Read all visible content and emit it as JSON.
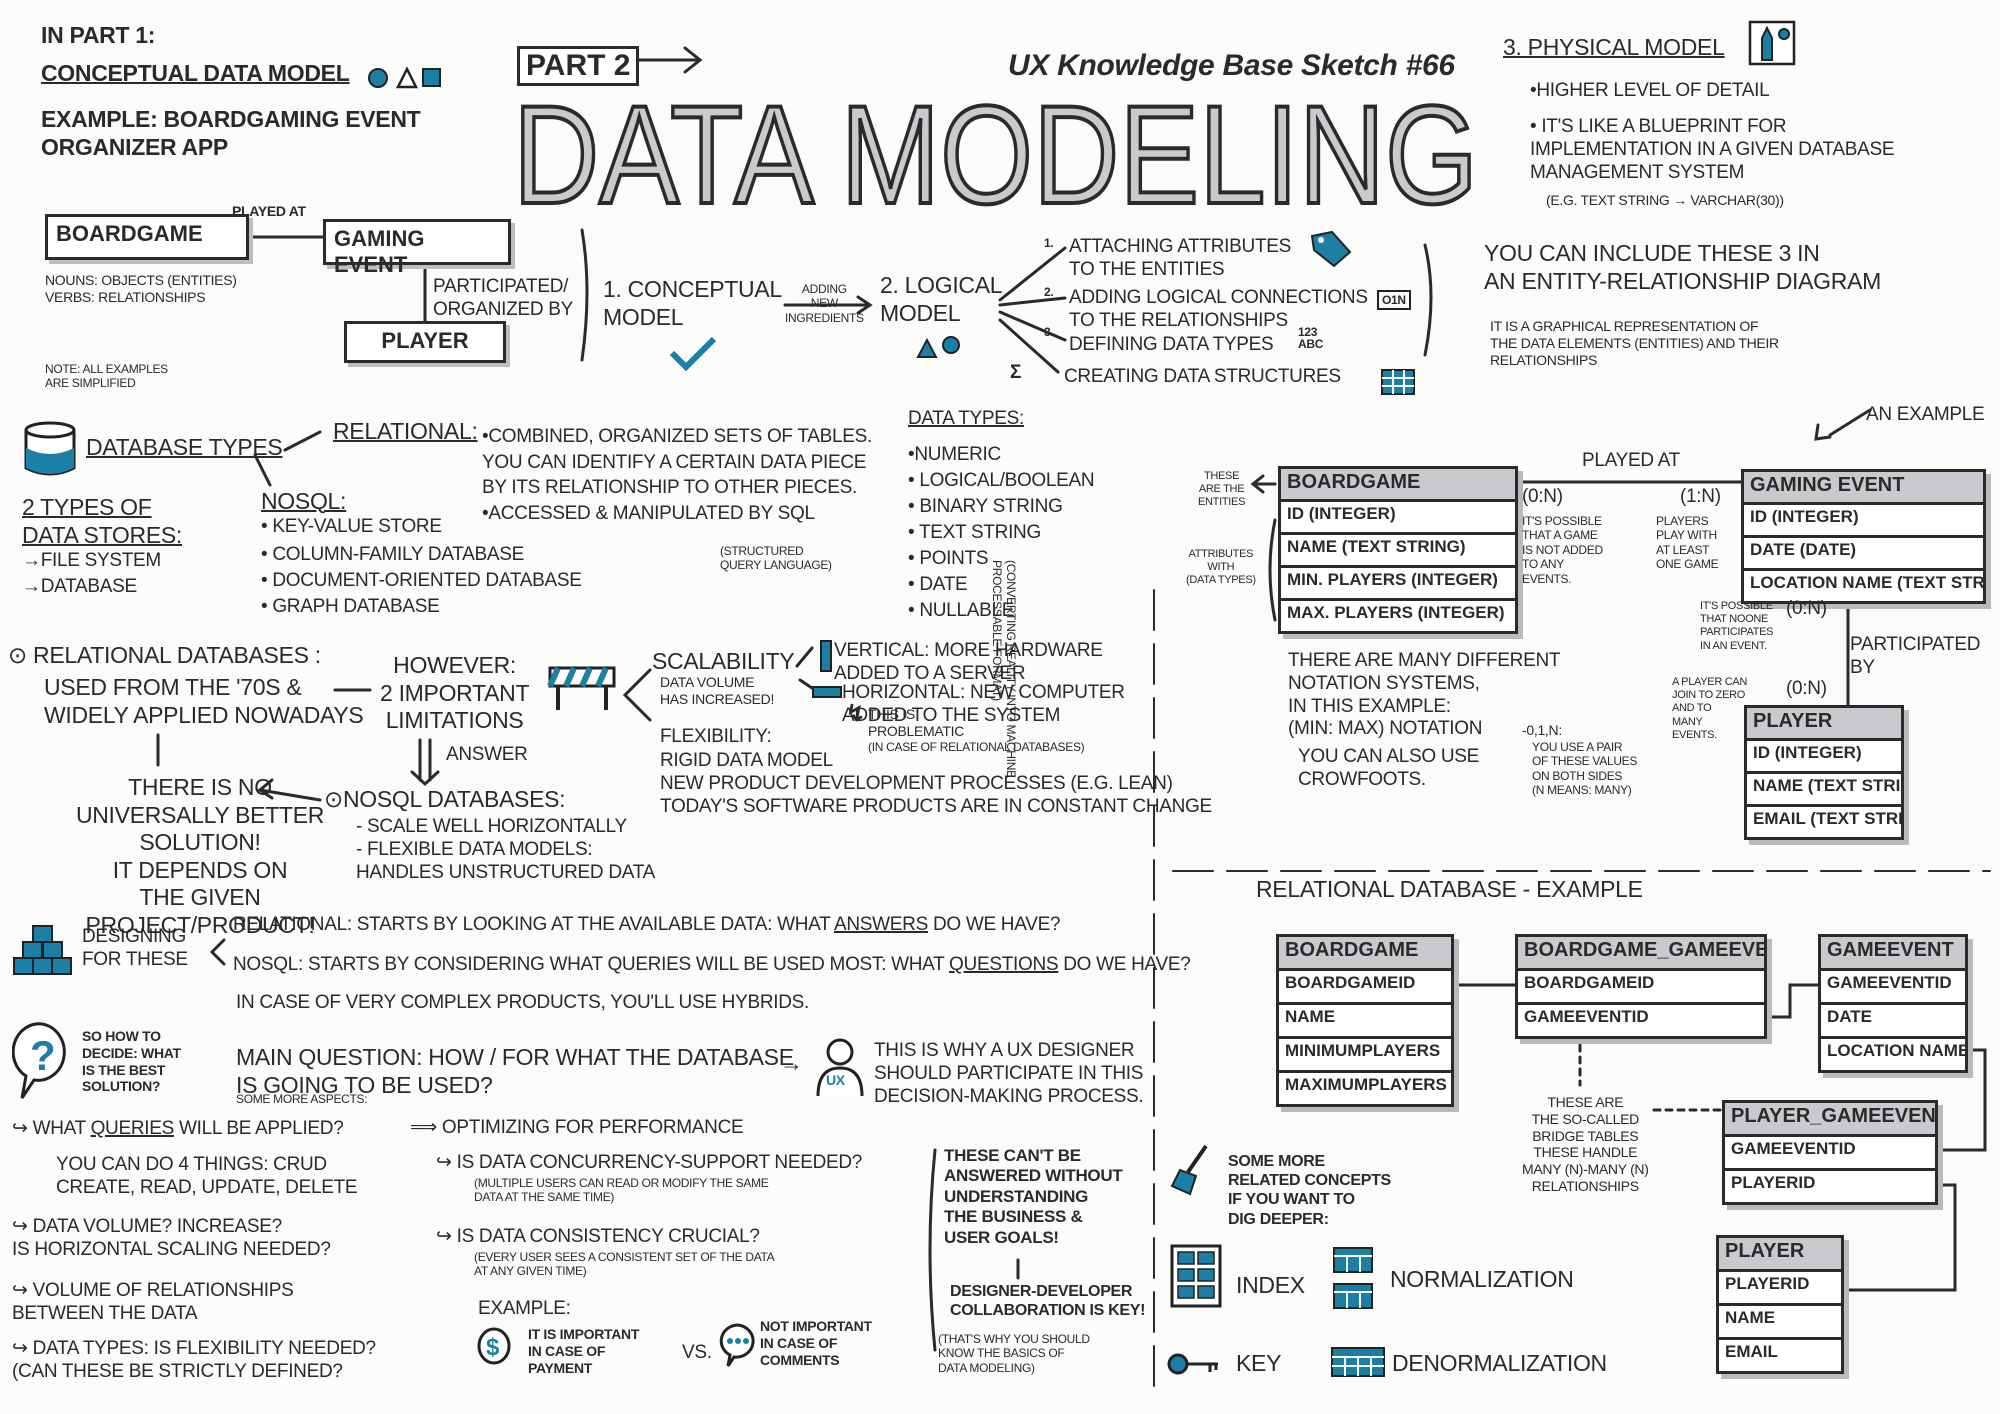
{
  "colors": {
    "accent": "#1b7fa6",
    "ink": "#2a2a2a",
    "gray_fill": "#c9cacd",
    "paper": "#fbfbfa"
  },
  "title": {
    "part": "PART 2",
    "main": "DATA MODELING",
    "series": "UX Knowledge Base Sketch #66"
  },
  "intro": {
    "part1": "IN PART 1:",
    "conceptual": "CONCEPTUAL DATA MODEL",
    "example": "EXAMPLE: BOARDGAMING EVENT\n          ORGANIZER APP"
  },
  "conceptual_example": {
    "boardgame": "BOARDGAME",
    "played_at": "PLAYED AT",
    "gaming_event": "GAMING EVENT",
    "participated": "PARTICIPATED/\nORGANIZED BY",
    "player": "PLAYER",
    "nouns": "NOUNS: OBJECTS (ENTITIES)\nVERBS: RELATIONSHIPS",
    "note": "NOTE: ALL EXAMPLES\n        ARE SIMPLIFIED"
  },
  "flow": {
    "conceptual": "1. CONCEPTUAL\n    MODEL",
    "adding": "ADDING\nNEW\nINGREDIENTS",
    "logical": "2. LOGICAL\n    MODEL",
    "steps": [
      {
        "num": "1.",
        "text": "ATTACHING ATTRIBUTES\nTO THE ENTITIES"
      },
      {
        "num": "2.",
        "text": "ADDING LOGICAL CONNECTIONS\nTO THE RELATIONSHIPS"
      },
      {
        "num": "3.",
        "text": "DEFINING DATA TYPES"
      }
    ],
    "type_badge": "123\nABC",
    "connector_badge": "O1N",
    "sigma": "Σ",
    "creating": "CREATING DATA STRUCTURES"
  },
  "physical": {
    "heading": "3. PHYSICAL MODEL",
    "bullets": [
      "•HIGHER LEVEL OF DETAIL",
      "• IT'S LIKE A BLUEPRINT FOR\n  IMPLEMENTATION IN A GIVEN DATABASE\n  MANAGEMENT SYSTEM"
    ],
    "example": "(E.G. TEXT STRING → VARCHAR(30))"
  },
  "erd_intro": {
    "text": "YOU CAN INCLUDE THESE 3 IN\nAN ENTITY-RELATIONSHIP DIAGRAM",
    "desc": "IT IS A GRAPHICAL REPRESENTATION OF\nTHE DATA ELEMENTS (ENTITIES) AND THEIR\nRELATIONSHIPS",
    "an_example": "AN EXAMPLE"
  },
  "database_types": {
    "label": "DATABASE TYPES",
    "stores": "2 TYPES OF\nDATA STORES:",
    "store_items": [
      "→FILE SYSTEM",
      "→DATABASE"
    ],
    "relational_label": "RELATIONAL:",
    "relational_text": "•COMBINED, ORGANIZED SETS OF TABLES.\n YOU CAN IDENTIFY A CERTAIN DATA PIECE\n BY ITS RELATIONSHIP TO OTHER PIECES.\n•ACCESSED & MANIPULATED BY SQL",
    "sql_note": "(STRUCTURED\nQUERY LANGUAGE)",
    "nosql_label": "NOSQL:",
    "nosql_items": [
      "• KEY-VALUE STORE",
      "• COLUMN-FAMILY DATABASE",
      "• DOCUMENT-ORIENTED DATABASE",
      "• GRAPH DATABASE"
    ]
  },
  "data_types": {
    "heading": "DATA TYPES:",
    "items": [
      "•NUMERIC",
      "• LOGICAL/BOOLEAN",
      "• BINARY STRING",
      "• TEXT STRING",
      "• POINTS",
      "• DATE",
      "• NULLABLE"
    ],
    "note": "(CONVERTING REALITY INTO MACHINE PROCESSABLE FORMAT)"
  },
  "relational_databases": {
    "heading": "⊙ RELATIONAL DATABASES :",
    "used": "USED FROM THE '70s &\nWIDELY APPLIED NOWADAYS",
    "however": "HOWEVER:\n2 IMPORTANT\nLIMITATIONS",
    "scalability": "SCALABILITY",
    "volume": "DATA VOLUME\nHAS INCREASED!",
    "vertical": "VERTICAL: MORE HARDWARE\n              ADDED TO A SERVER",
    "horizontal": "HORIZONTAL: NEW COMPUTER\n                ADDED TO THE SYSTEM",
    "problematic": "THIS IS\nPROBLEMATIC",
    "problematic_note": "(IN CASE OF RELATIONAL DATABASES)",
    "flexibility": "FLEXIBILITY:",
    "flex_items": "RIGID DATA MODEL\nNEW PRODUCT DEVELOPMENT PROCESSES (E.G. LEAN)\nTODAY'S SOFTWARE PRODUCTS ARE IN CONSTANT CHANGE",
    "answer": "ANSWER",
    "nosql_heading": "⊙NOSQL DATABASES:",
    "nosql_items": "- SCALE WELL HORIZONTALLY\n- FLEXIBLE DATA MODELS:\n  HANDLES UNSTRUCTURED DATA",
    "conclusion": "THERE IS NO\nUNIVERSALLY BETTER\nSOLUTION!\nIT DEPENDS ON\nTHE GIVEN PROJECT/PRODUCT!"
  },
  "designing": {
    "label": "DESIGNING\nFOR THESE",
    "relational_prefix": "RELATIONAL: STARTS BY LOOKING AT THE AVAILABLE DATA: WHAT ",
    "relational_key": "ANSWERS",
    "relational_suffix": " DO WE HAVE?",
    "nosql_prefix": "NOSQL: STARTS BY CONSIDERING WHAT QUERIES WILL BE USED MOST: WHAT ",
    "nosql_key": "QUESTIONS",
    "nosql_suffix": " DO WE HAVE?",
    "hybrids": "IN CASE OF VERY COMPLEX PRODUCTS, YOU'LL USE HYBRIDS."
  },
  "decide": {
    "question": "SO HOW TO\nDECIDE: WHAT\nIS THE BEST\nSOLUTION?",
    "main": "MAIN QUESTION:  HOW / FOR WHAT THE DATABASE\n                          IS GOING TO BE USED?",
    "ux_badge": "UX",
    "ux_text": "THIS IS WHY A UX DESIGNER\nSHOULD PARTICIPATE IN THIS\nDECISION-MAKING PROCESS.",
    "aspects": "SOME MORE ASPECTS:"
  },
  "aspects": {
    "queries_prefix": "↪ WHAT ",
    "queries_key": "QUERIES",
    "queries_suffix": " WILL BE APPLIED?",
    "optimizing": "⟹ OPTIMIZING FOR PERFORMANCE",
    "crud": "YOU CAN DO 4 THINGS: CRUD\nCREATE, READ, UPDATE, DELETE",
    "volume": "↪ DATA VOLUME? INCREASE?\n   IS HORIZONTAL SCALING NEEDED?",
    "relationships": "↪ VOLUME OF RELATIONSHIPS\n   BETWEEN THE DATA",
    "types": "↪ DATA TYPES: IS FLEXIBILITY NEEDED?\n   (CAN THESE BE STRICTLY DEFINED?",
    "concurrency": "↪ IS DATA CONCURRENCY-SUPPORT NEEDED?",
    "concurrency_note": "(MULTIPLE USERS CAN READ OR MODIFY THE SAME\nDATA AT THE SAME TIME)",
    "consistency": "↪ IS DATA CONSISTENCY CRUCIAL?",
    "consistency_note": "(EVERY USER SEES A CONSISTENT SET OF THE DATA\nAT ANY GIVEN TIME)",
    "example": "EXAMPLE:",
    "payment": "IT IS IMPORTANT\nIN CASE OF\nPAYMENT",
    "vs": "VS.",
    "comments": "NOT IMPORTANT\nIN CASE OF\nCOMMENTS",
    "business": "THESE CAN'T BE\nANSWERED WITHOUT\nUNDERSTANDING\nTHE BUSINESS &\nUSER GOALS!",
    "collab": "DESIGNER-DEVELOPER\nCOLLABORATION IS KEY!",
    "collab_note": "(THAT'S WHY YOU SHOULD\nKNOW THE BASICS OF\nDATA MODELING)"
  },
  "er_example": {
    "played_at": "PLAYED AT",
    "participated_by": "PARTICIPATED\nBY",
    "entities_note": "THESE\nARE THE\nENTITIES",
    "attributes_note": "ATTRIBUTES\nWITH\n(DATA TYPES)",
    "card_bg": "(0:N)",
    "card_bg_note": "IT'S POSSIBLE\nTHAT A GAME\nIS NOT ADDED\nTO ANY\nEVENTS.",
    "card_ge": "(1:N)",
    "card_ge_note": "PLAYERS\nPLAY WITH\nAT LEAST\nONE GAME",
    "card_ge_p": "(0:N)",
    "card_ge_p_note": "IT'S POSSIBLE\nTHAT NOONE\nPARTICIPATES\nIN AN EVENT.",
    "card_p": "(0:N)",
    "card_p_note": "A PLAYER CAN\nJOIN TO ZERO\nAND TO\nMANY\nEVENTS.",
    "notation": "THERE ARE MANY DIFFERENT\nNOTATION SYSTEMS,\nIN THIS EXAMPLE:\n(MIN: MAX) NOTATION",
    "notation_values": "-0,1,N:",
    "notation_note": "YOU USE A PAIR\nOF THESE VALUES\nON BOTH SIDES\n(N MEANS: MANY)",
    "crowfoots": "YOU CAN ALSO USE\nCROWFOOTS.",
    "entities": [
      {
        "name": "BOARDGAME",
        "attributes": [
          "ID (INTEGER)",
          "NAME (TEXT STRING)",
          "MIN. PLAYERS (INTEGER)",
          "MAX. PLAYERS (INTEGER)"
        ]
      },
      {
        "name": "GAMING EVENT",
        "attributes": [
          "ID (INTEGER)",
          "DATE (DATE)",
          "LOCATION NAME (TEXT STRING)"
        ]
      },
      {
        "name": "PLAYER",
        "attributes": [
          "ID (INTEGER)",
          "NAME (TEXT STRING)",
          "EMAIL (TEXT STRING"
        ]
      }
    ]
  },
  "relational_example": {
    "title": "RELATIONAL DATABASE - EXAMPLE",
    "bridge_note": "THESE ARE\nTHE SO-CALLED\nBRIDGE TABLES\nTHESE HANDLE\nMANY (N)-MANY (N)\nRELATIONSHIPS",
    "tables": [
      {
        "name": "BOARDGAME",
        "columns": [
          "BOARDGAMEID",
          "NAME",
          "MINIMUMPLAYERS",
          "MAXIMUMPLAYERS"
        ]
      },
      {
        "name": "BOARDGAME_GAMEEVENT",
        "columns": [
          "BOARDGAMEID",
          "GAMEEVENTID"
        ]
      },
      {
        "name": "GAMEEVENT",
        "columns": [
          "GAMEEVENTID",
          "DATE",
          "LOCATION NAME"
        ]
      },
      {
        "name": "PLAYER_GAMEEVENT",
        "columns": [
          "GAMEEVENTID",
          "PLAYERID"
        ]
      },
      {
        "name": "PLAYER",
        "columns": [
          "PLAYERID",
          "NAME",
          "EMAIL"
        ]
      }
    ]
  },
  "related": {
    "heading": "SOME MORE\nRELATED CONCEPTS\nIF YOU WANT TO\nDIG DEEPER:",
    "index": "INDEX",
    "normalization": "NORMALIZATION",
    "key": "KEY",
    "denormalization": "DENORMALIZATION"
  }
}
